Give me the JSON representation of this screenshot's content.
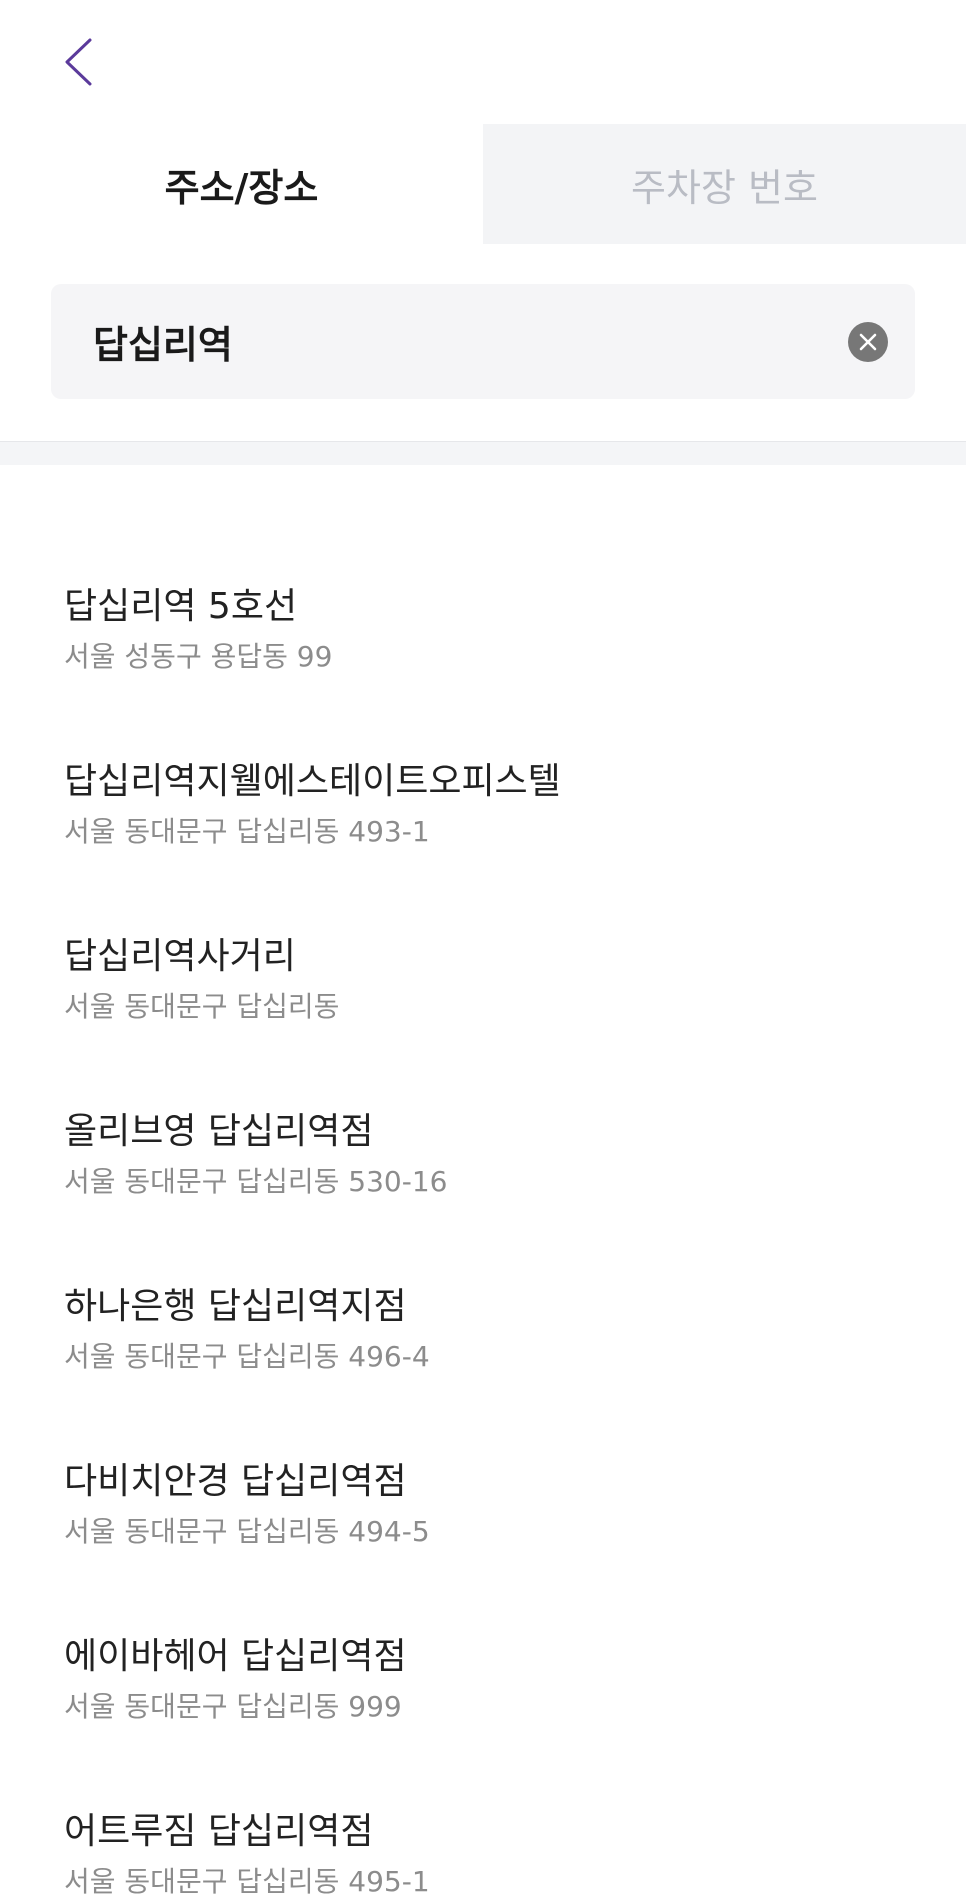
{
  "header": {
    "back_icon": "chevron-left-icon",
    "accent_color": "#5b3a9b"
  },
  "tabs": [
    {
      "label": "주소/장소",
      "active": true
    },
    {
      "label": "주차장 번호",
      "active": false
    }
  ],
  "search": {
    "value": "답십리역",
    "clear_icon": "clear-circle-icon"
  },
  "results": [
    {
      "name": "답십리역 5호선",
      "address": "서울 성동구 용답동 99"
    },
    {
      "name": "답십리역지웰에스테이트오피스텔",
      "address": "서울 동대문구 답십리동 493-1"
    },
    {
      "name": "답십리역사거리",
      "address": "서울 동대문구 답십리동"
    },
    {
      "name": "올리브영 답십리역점",
      "address": "서울 동대문구 답십리동 530-16"
    },
    {
      "name": "하나은행 답십리역지점",
      "address": "서울 동대문구 답십리동 496-4"
    },
    {
      "name": "다비치안경 답십리역점",
      "address": "서울 동대문구 답십리동 494-5"
    },
    {
      "name": "에이바헤어 답십리역점",
      "address": "서울 동대문구 답십리동 999"
    },
    {
      "name": "어트루짐 답십리역점",
      "address": "서울 동대문구 답십리동 495-1"
    }
  ]
}
